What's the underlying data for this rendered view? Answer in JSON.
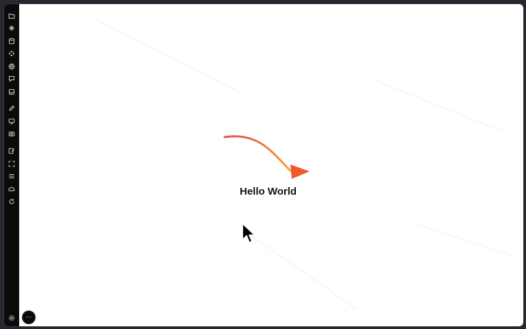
{
  "canvas": {
    "text": "Hello World"
  },
  "sidebar": {
    "items": [
      {
        "name": "folder-icon"
      },
      {
        "name": "sparkle-icon"
      },
      {
        "name": "database-icon"
      },
      {
        "name": "move-icon"
      },
      {
        "name": "globe-icon"
      },
      {
        "name": "chat-icon"
      },
      {
        "name": "inbox-icon"
      },
      {
        "name": "pencil-icon"
      },
      {
        "name": "monitor-icon"
      },
      {
        "name": "camera-icon"
      },
      {
        "name": "edit-icon"
      },
      {
        "name": "fullscreen-icon"
      },
      {
        "name": "list-icon"
      },
      {
        "name": "cloud-icon"
      },
      {
        "name": "refresh-icon"
      },
      {
        "name": "settings-icon"
      }
    ]
  },
  "more_button": {
    "label": "···"
  },
  "colors": {
    "arrow_start": "#e0554f",
    "arrow_end": "#f2a83a",
    "arrow_head": "#ee5a2a",
    "sidebar_bg": "#0b0b0c"
  }
}
